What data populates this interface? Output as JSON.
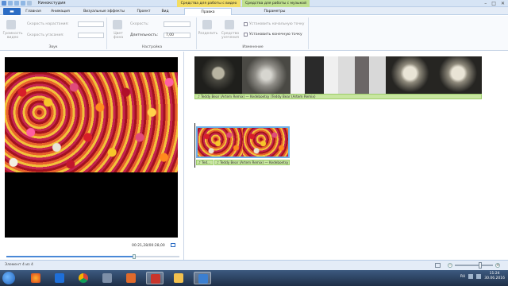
{
  "window": {
    "title": "Кинокстудия",
    "context_tab_video": "Средства для работы с видео",
    "context_tab_music": "Средства для работы с музыкой",
    "btn_minimize": "–",
    "btn_maximize": "□",
    "btn_close": "✕"
  },
  "tabs": {
    "file": "▬",
    "items": [
      "Главная",
      "Анимация",
      "Визуальные эффекты",
      "Проект",
      "Вид",
      "Правка",
      "Параметры"
    ]
  },
  "ribbon": {
    "sound": {
      "volume_label": "Громкость видео",
      "fade_in_label": "Скорость нарастания:",
      "fade_out_label": "Скорость угасания:",
      "group_label": "Звук"
    },
    "adjust": {
      "bg_color_label": "Цвет фона",
      "speed_label": "Скорость:",
      "duration_label": "Длительность:",
      "duration_value": "7,00",
      "group_label": "Настройка"
    },
    "editing": {
      "split_label": "Разделить",
      "trim_label": "Средство усечения",
      "set_start_label": "Установить начальную точку",
      "set_end_label": "Установить конечную точку",
      "group_label": "Изменение"
    }
  },
  "player": {
    "timecode": "00:21,28/00:28,00",
    "seek_fraction": 0.74,
    "prev_icon": "◀|",
    "play_icon": "▶",
    "next_icon": "|▶"
  },
  "timeline": {
    "music1_label": "♪ Teddy Bear (Artem Remix) — Kedeboetsy (Teddy Bear (Artem Remix)",
    "music2a_label": "♪ Ted...",
    "music2b_label": "♪ Teddy Bear (Artem Remix) — Kedeboetsy (Teddy Bear"
  },
  "status": {
    "text": "Элемент 4 из 4",
    "zoom_out": "−",
    "zoom_in": "+"
  },
  "taskbar": {
    "lang": "RU",
    "time": "11:24",
    "date": "30.06.2016"
  },
  "colors": {
    "accent": "#2b6cc4",
    "context_video": "#f3dd63",
    "context_music": "#bfe08e",
    "music_track": "#c8e6a0"
  }
}
